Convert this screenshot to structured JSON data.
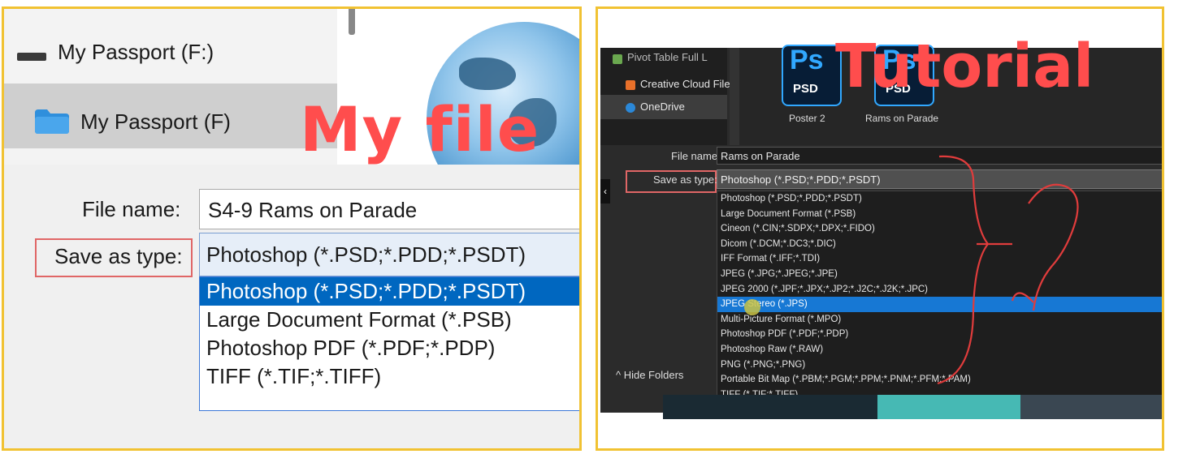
{
  "left": {
    "nav": {
      "drive_label": "My Passport (F:)",
      "folder_label": "My Passport (F)"
    },
    "file_name": {
      "label": "File name:",
      "value": "S4-9 Rams on Parade"
    },
    "save_as_type": {
      "label": "Save as type:",
      "selected": "Photoshop (*.PSD;*.PDD;*.PSDT)",
      "options": [
        "Photoshop (*.PSD;*.PDD;*.PSDT)",
        "Large Document Format (*.PSB)",
        "Photoshop PDF (*.PDF;*.PDP)",
        "TIFF (*.TIF;*.TIFF)"
      ],
      "highlighted_index": 0
    },
    "overlay_text": "My file"
  },
  "right": {
    "nav": {
      "items": [
        "Pivot Table Full L",
        "Creative Cloud File",
        "OneDrive"
      ]
    },
    "files": [
      {
        "icon": "PSD",
        "label": "Poster 2"
      },
      {
        "icon": "PSD",
        "label": "Rams on Parade"
      }
    ],
    "ps_glyph": "Ps",
    "file_name": {
      "label": "File name:",
      "value": "Rams on Parade"
    },
    "save_as_type": {
      "label": "Save as type:",
      "selected": "Photoshop (*.PSD;*.PDD;*.PSDT)",
      "options": [
        "Photoshop (*.PSD;*.PDD;*.PSDT)",
        "Large Document Format (*.PSB)",
        "Cineon (*.CIN;*.SDPX;*.DPX;*.FIDO)",
        "Dicom (*.DCM;*.DC3;*.DIC)",
        "IFF Format (*.IFF;*.TDI)",
        "JPEG (*.JPG;*.JPEG;*.JPE)",
        "JPEG 2000 (*.JPF;*.JPX;*.JP2;*.J2C;*.J2K;*.JPC)",
        "JPEG Stereo (*.JPS)",
        "Multi-Picture Format (*.MPO)",
        "Photoshop PDF (*.PDF;*.PDP)",
        "Photoshop Raw (*.RAW)",
        "PNG (*.PNG;*.PNG)",
        "Portable Bit Map (*.PBM;*.PGM;*.PPM;*.PNM;*.PFM;*.PAM)",
        "TIFF (*.TIF;*.TIFF)"
      ],
      "highlighted_index": 7
    },
    "hide_folders": "^ Hide Folders",
    "overlay_text": "Tutorial",
    "annotation_mark": "?"
  },
  "colors": {
    "frame": "#f1c232",
    "overlay": "#ff4d4d",
    "highlight_left": "#0067c0",
    "highlight_right": "#1778d4",
    "red_box": "#e06666"
  }
}
